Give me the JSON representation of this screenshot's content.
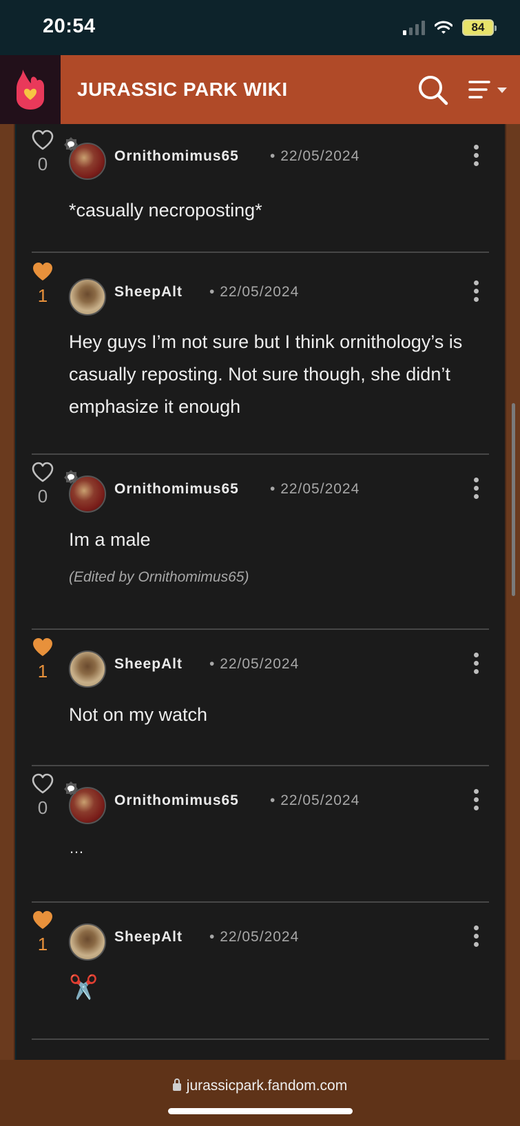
{
  "status_bar": {
    "time": "20:54",
    "battery": "84"
  },
  "header": {
    "title": "JURASSIC PARK WIKI"
  },
  "posts": [
    {
      "author": "Ornithomimus65",
      "date": "22/05/2024",
      "likes": "0",
      "liked": false,
      "body": "*casually necroposting*",
      "edited": ""
    },
    {
      "author": "SheepAlt",
      "date": "22/05/2024",
      "likes": "1",
      "liked": true,
      "body": "Hey guys I’m not sure but I think ornithology’s is casually reposting. Not sure though, she didn’t emphasize it enough",
      "edited": ""
    },
    {
      "author": "Ornithomimus65",
      "date": "22/05/2024",
      "likes": "0",
      "liked": false,
      "body": "Im a male",
      "edited": "(Edited by Ornithomimus65)"
    },
    {
      "author": "SheepAlt",
      "date": "22/05/2024",
      "likes": "1",
      "liked": true,
      "body": "Not on my watch",
      "edited": ""
    },
    {
      "author": "Ornithomimus65",
      "date": "22/05/2024",
      "likes": "0",
      "liked": false,
      "body": "…",
      "edited": ""
    },
    {
      "author": "SheepAlt",
      "date": "22/05/2024",
      "likes": "1",
      "liked": true,
      "body": "✂️",
      "edited": ""
    }
  ],
  "colors": {
    "accent": "#e8913b",
    "header_bg": "#b04a28",
    "content_bg": "#1b1b1b"
  },
  "browser": {
    "url": "jurassicpark.fandom.com"
  }
}
